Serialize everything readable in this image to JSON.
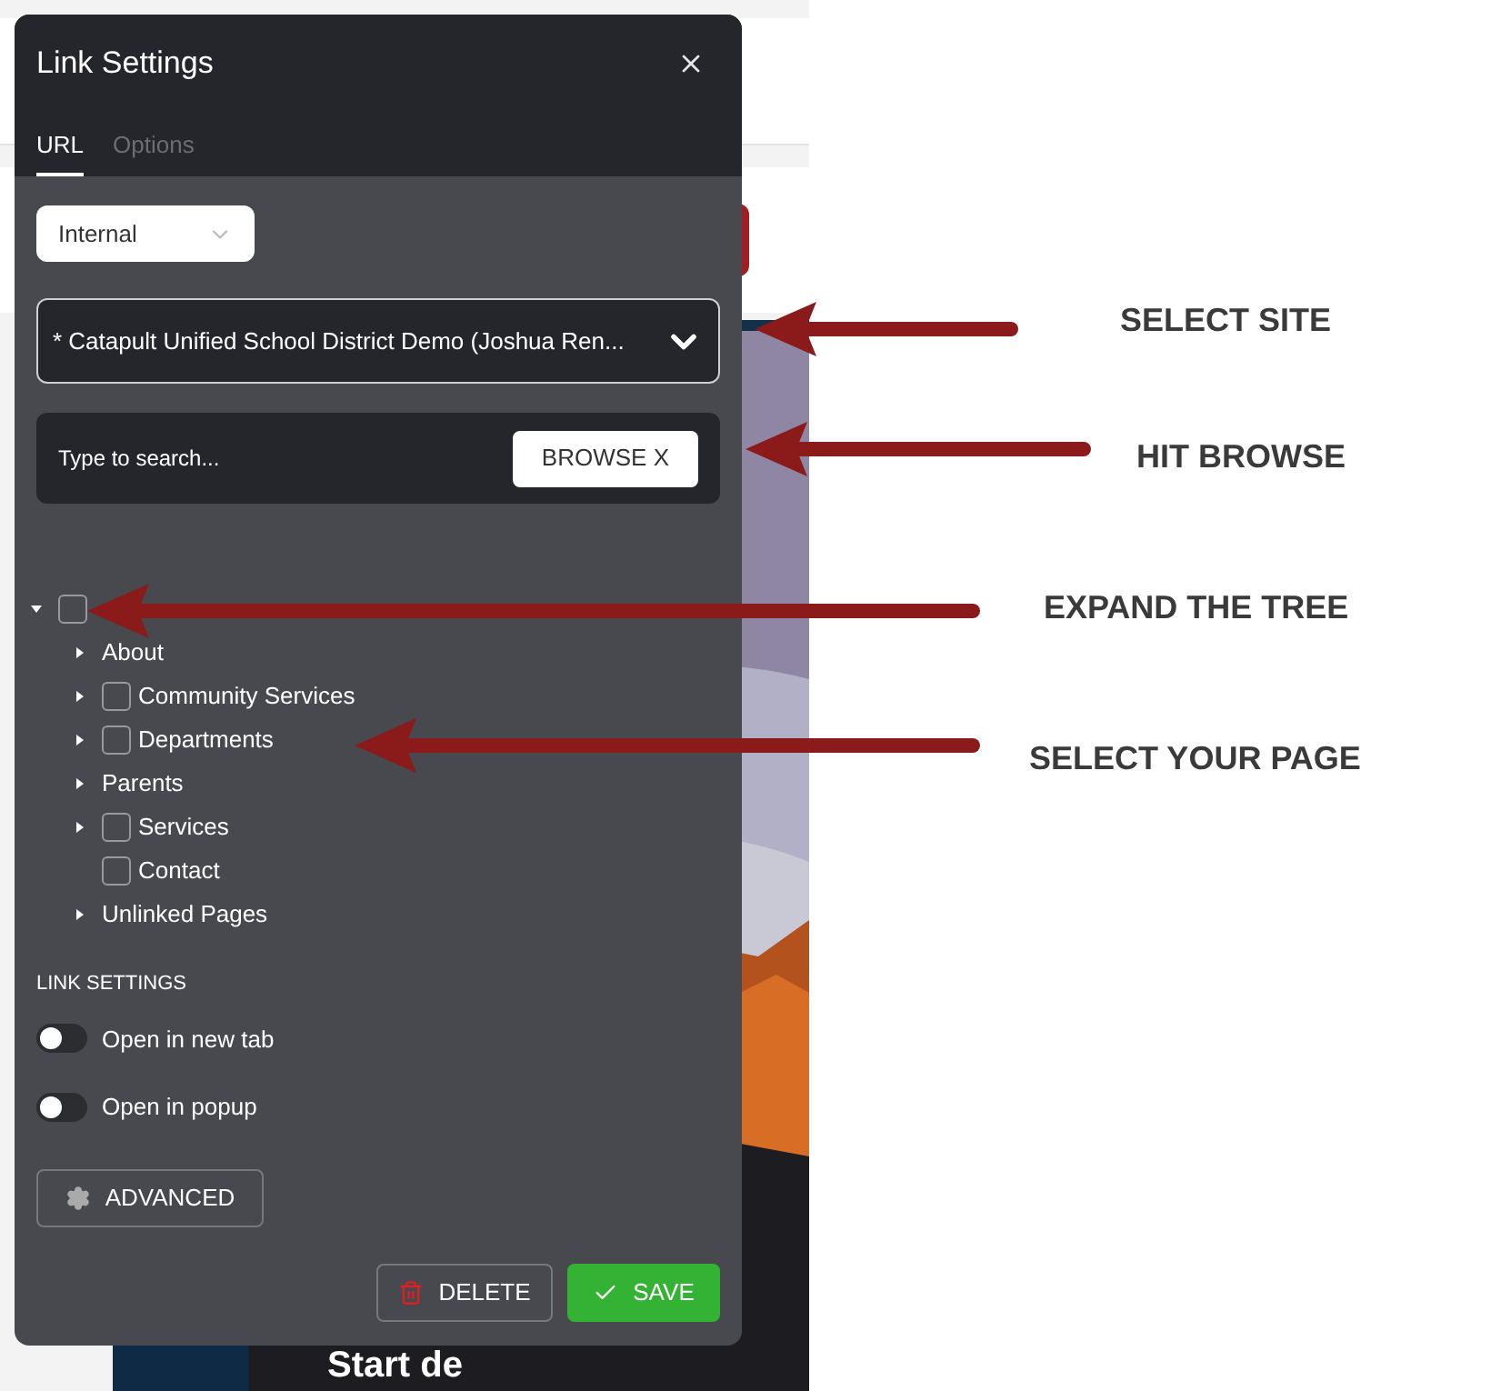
{
  "dialog": {
    "title": "Link Settings",
    "tabs": [
      {
        "label": "URL",
        "selected": true
      },
      {
        "label": "Options",
        "selected": false
      }
    ],
    "link_type": "Internal",
    "site": "* Catapult Unified School District Demo (Joshua Ren...",
    "search": {
      "placeholder": "Type to search...",
      "button": "BROWSE X"
    },
    "tree": [
      {
        "kind": "checkable",
        "checked": false,
        "expanded": true,
        "children": [
          {
            "label": "About",
            "kind": "plain",
            "expanded": false
          },
          {
            "label": "Community Services",
            "kind": "checkable",
            "checked": false,
            "expanded": false
          },
          {
            "label": "Departments",
            "kind": "checkable",
            "checked": false,
            "expanded": false
          },
          {
            "label": "Parents",
            "kind": "plain",
            "expanded": false
          },
          {
            "label": "Services",
            "kind": "checkable",
            "checked": false,
            "expanded": false
          },
          {
            "label": "Contact",
            "kind": "checkable",
            "checked": false
          },
          {
            "label": "Unlinked Pages",
            "kind": "plain",
            "expanded": false
          }
        ]
      }
    ],
    "section_title": "LINK SETTINGS",
    "toggles": [
      {
        "label": "Open in new tab",
        "on": false
      },
      {
        "label": "Open in popup",
        "on": false
      }
    ],
    "advanced": "ADVANCED",
    "delete": "DELETE",
    "save": "SAVE"
  },
  "hero_text": "Start de",
  "annotations": [
    {
      "label": "SELECT SITE"
    },
    {
      "label": "HIT BROWSE"
    },
    {
      "label": "EXPAND THE TREE"
    },
    {
      "label": "SELECT YOUR PAGE"
    }
  ]
}
